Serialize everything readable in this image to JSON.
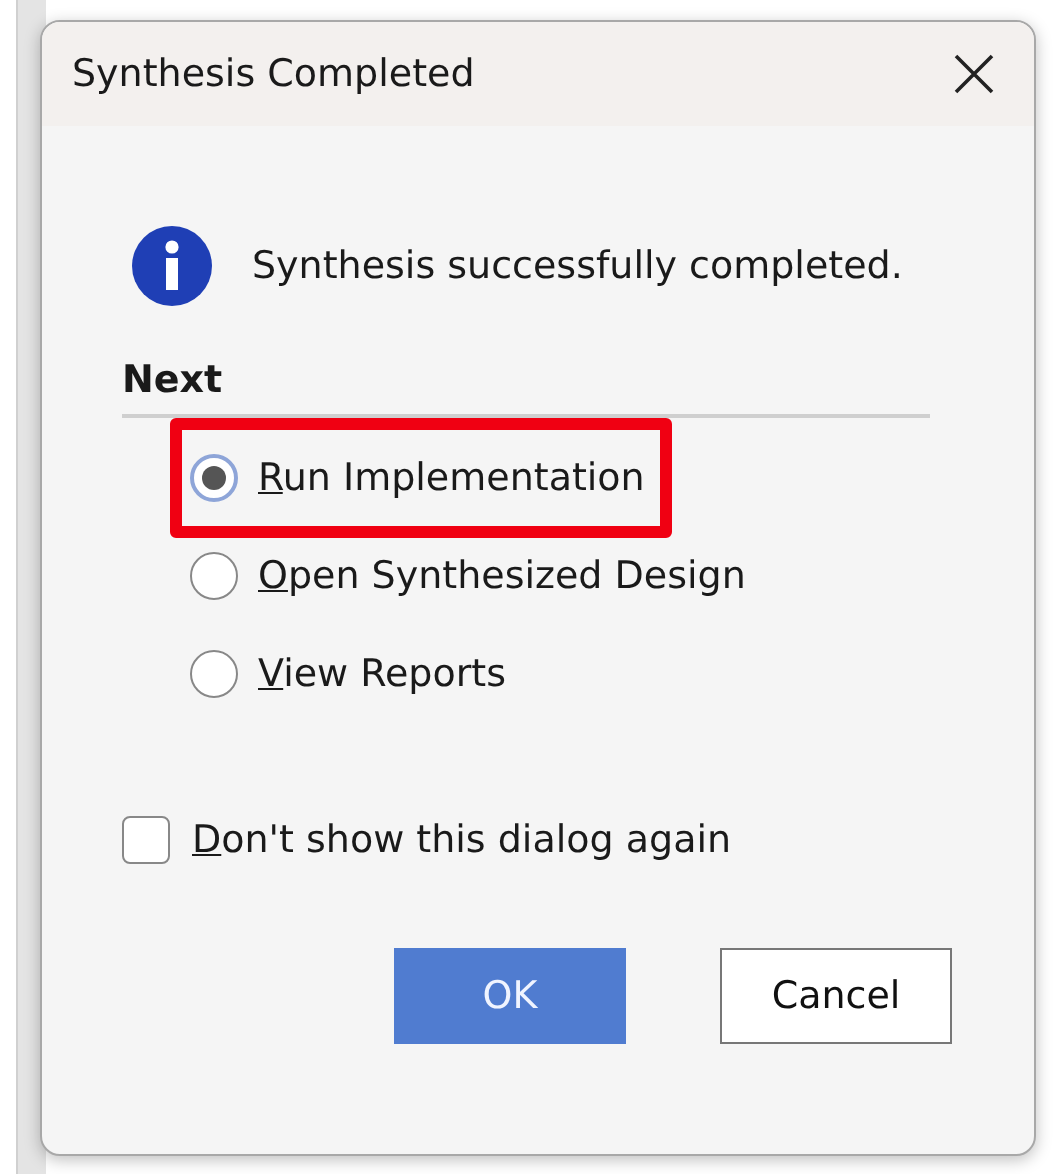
{
  "dialog": {
    "title": "Synthesis Completed",
    "message": "Synthesis successfully completed.",
    "section": "Next",
    "options": [
      {
        "label": "Run Implementation",
        "selected": true,
        "highlighted": true
      },
      {
        "label": "Open Synthesized Design",
        "selected": false,
        "highlighted": false
      },
      {
        "label": "View Reports",
        "selected": false,
        "highlighted": false
      }
    ],
    "dont_show": {
      "label": "Don't show this dialog again",
      "checked": false
    },
    "buttons": [
      {
        "label": "OK",
        "kind": "primary"
      },
      {
        "label": "Cancel",
        "kind": "secondary"
      }
    ]
  }
}
